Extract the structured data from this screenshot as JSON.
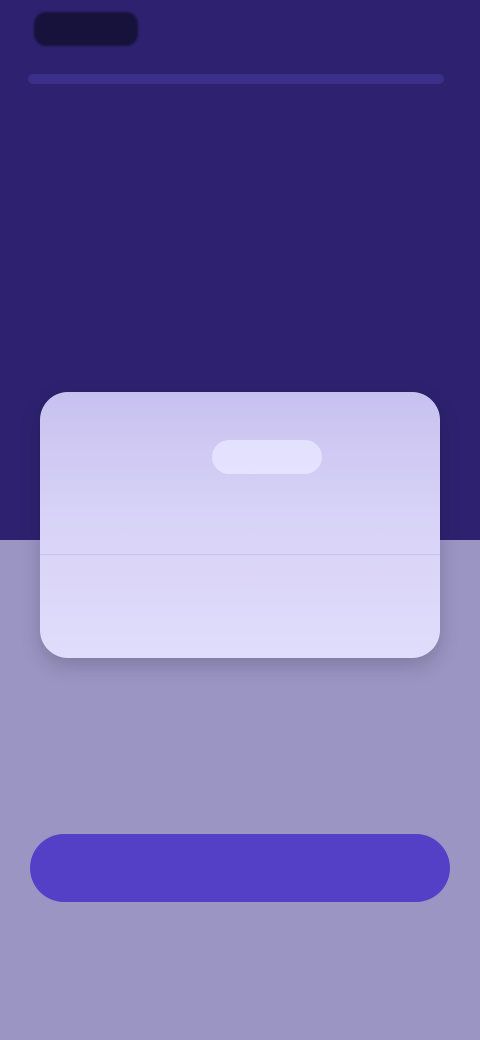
{
  "header": {
    "logo": "",
    "right_action": "",
    "headline": "",
    "subtitle": ""
  },
  "card": {
    "title": "",
    "meta": "",
    "left_action": "",
    "right_action": ""
  },
  "footer": {
    "caption": "",
    "primary_cta": "",
    "secondary_link": ""
  }
}
